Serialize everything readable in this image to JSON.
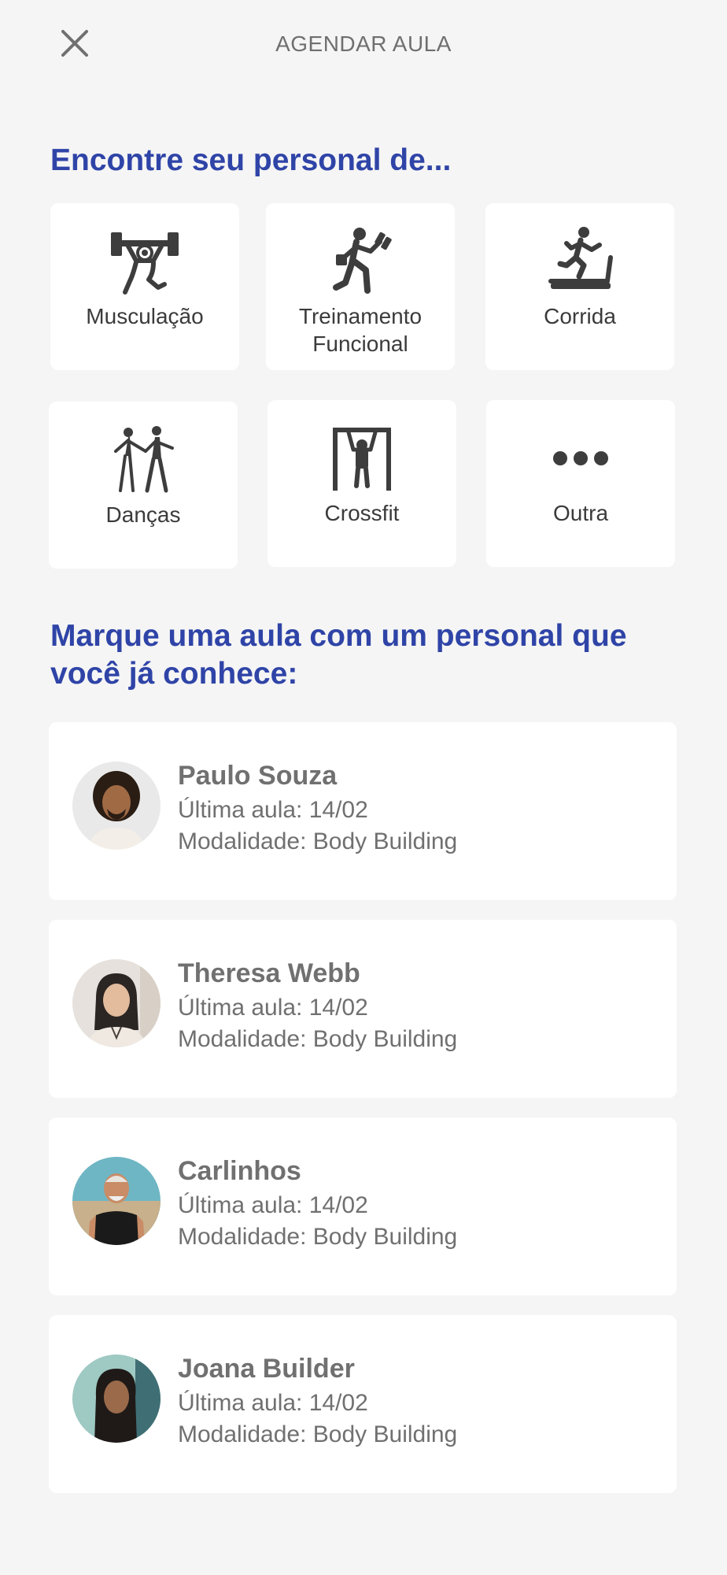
{
  "header": {
    "title": "AGENDAR AULA"
  },
  "section_categories": {
    "title": "Encontre seu personal de...",
    "items": [
      {
        "label": "Musculação",
        "icon": "weightlifting-icon"
      },
      {
        "label": "Treinamento Funcional",
        "icon": "functional-training-icon"
      },
      {
        "label": "Corrida",
        "icon": "treadmill-icon"
      },
      {
        "label": "Danças",
        "icon": "dancing-couple-icon"
      },
      {
        "label": "Crossfit",
        "icon": "pull-up-bar-icon"
      },
      {
        "label": "Outra",
        "icon": "more-dots-icon"
      }
    ]
  },
  "section_trainers": {
    "title": "Marque uma aula com um personal que você já conhece:",
    "items": [
      {
        "name": "Paulo Souza",
        "last_class": "Última aula: 14/02",
        "modality": "Modalidade: Body Building"
      },
      {
        "name": "Theresa Webb",
        "last_class": "Última aula: 14/02",
        "modality": "Modalidade: Body Building"
      },
      {
        "name": "Carlinhos",
        "last_class": "Última aula: 14/02",
        "modality": "Modalidade: Body Building"
      },
      {
        "name": "Joana Builder",
        "last_class": "Última aula: 14/02",
        "modality": "Modalidade: Body Building"
      }
    ]
  },
  "colors": {
    "accent": "#2f44a7",
    "background": "#f5f5f5",
    "card": "#ffffff",
    "text_secondary": "#707070",
    "icon": "#3d3d3d"
  }
}
